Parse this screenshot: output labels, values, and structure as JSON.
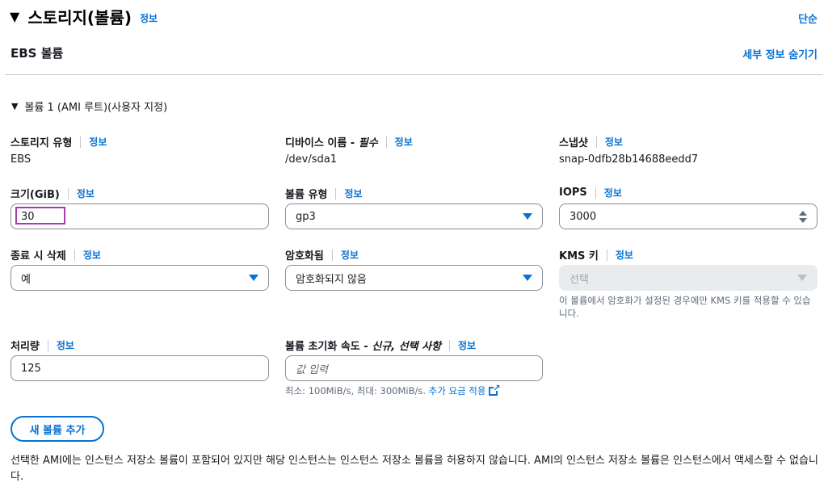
{
  "header": {
    "title": "스토리지(볼륨)",
    "info": "정보",
    "simple_link": "단순"
  },
  "ebs": {
    "title": "EBS 볼륨",
    "hide_details": "세부 정보 숨기기"
  },
  "volume": {
    "heading": "볼륨 1 (AMI 루트)(사용자 지정)",
    "storage_type": {
      "label": "스토리지 유형",
      "info": "정보",
      "value": "EBS"
    },
    "device_name": {
      "label": "디바이스 이름 - ",
      "label_em": "필수",
      "info": "정보",
      "value": "/dev/sda1"
    },
    "snapshot": {
      "label": "스냅샷",
      "info": "정보",
      "value": "snap-0dfb28b14688eedd7"
    },
    "size": {
      "label": "크기(GiB)",
      "info": "정보",
      "value": "30"
    },
    "volume_type": {
      "label": "볼륨 유형",
      "info": "정보",
      "value": "gp3"
    },
    "iops": {
      "label": "IOPS",
      "info": "정보",
      "value": "3000"
    },
    "delete_on_termination": {
      "label": "종료 시 삭제",
      "info": "정보",
      "value": "예"
    },
    "encrypted": {
      "label": "암호화됨",
      "info": "정보",
      "value": "암호화되지 않음"
    },
    "kms_key": {
      "label": "KMS 키",
      "info": "정보",
      "placeholder": "선택",
      "hint": "이 볼륨에서 암호화가 설정된 경우에만 KMS 키를 적용할 수 있습니다."
    },
    "throughput": {
      "label": "처리량",
      "info": "정보",
      "value": "125"
    },
    "init_rate": {
      "label": "볼륨 초기화 속도 - ",
      "label_em": "신규, 선택 사항",
      "info": "정보",
      "placeholder": "값 입력",
      "hint_prefix": "최소: 100MiB/s, 최대: 300MiB/s. ",
      "hint_link": "추가 요금 적용"
    }
  },
  "add_volume_button": "새 볼륨 추가",
  "notice": "선택한 AMI에는 인스턴스 저장소 볼륨이 포함되어 있지만 해당 인스턴스는 인스턴스 저장소 볼륨을 허용하지 않습니다. AMI의 인스턴스 저장소 볼륨은 인스턴스에서 액세스할 수 없습니다.",
  "colors": {
    "accent": "#0972d3",
    "focus_outline": "#a53dae"
  }
}
